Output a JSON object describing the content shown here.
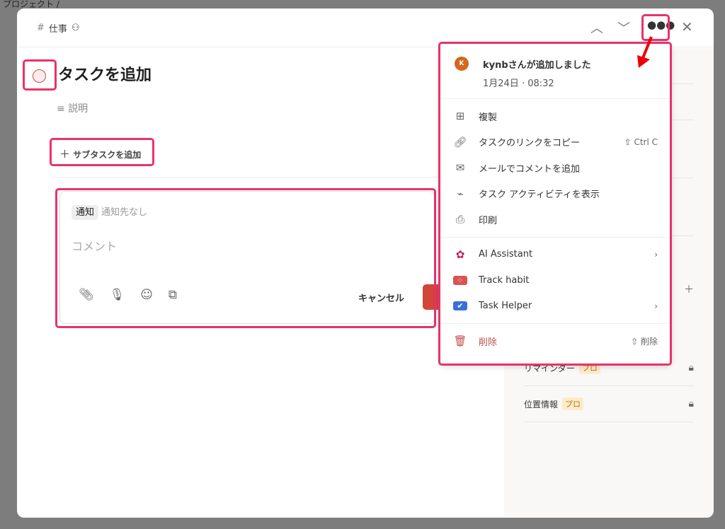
{
  "breadcrumb": "プロジェクト /",
  "header": {
    "project": "仕事",
    "hash": "#"
  },
  "task": {
    "title": "タスクを追加",
    "description_placeholder": "説明",
    "add_subtask": "サブタスクを追加"
  },
  "comment": {
    "notify_label": "通知",
    "notify_value": "通知先なし",
    "placeholder": "コメント",
    "cancel": "キャンセル"
  },
  "sidebar": {
    "rows": [
      {
        "label": "リマインダー",
        "badge": "プロ"
      },
      {
        "label": "位置情報",
        "badge": "プロ"
      }
    ]
  },
  "menu": {
    "avatar": "K",
    "added_by": "kynbさんが追加しました",
    "added_at": "1月24日 · 08:32",
    "items": [
      {
        "label": "複製",
        "icon": "duplicate-icon"
      },
      {
        "label": "タスクのリンクをコピー",
        "shortcut": "⇧ Ctrl C",
        "icon": "link-icon"
      },
      {
        "label": "メールでコメントを追加",
        "icon": "mail-icon"
      },
      {
        "label": "タスク アクティビティを表示",
        "icon": "activity-icon"
      },
      {
        "label": "印刷",
        "icon": "print-icon"
      },
      {
        "label": "AI Assistant",
        "icon": "ai-icon"
      },
      {
        "label": "Track habit",
        "icon": "habit-icon"
      },
      {
        "label": "Task Helper",
        "icon": "helper-icon"
      },
      {
        "label": "削除",
        "shortcut": "⇧ 削除",
        "icon": "trash-icon"
      }
    ]
  },
  "colors": {
    "annotation": "#e8336a",
    "accent": "#d1453b"
  }
}
